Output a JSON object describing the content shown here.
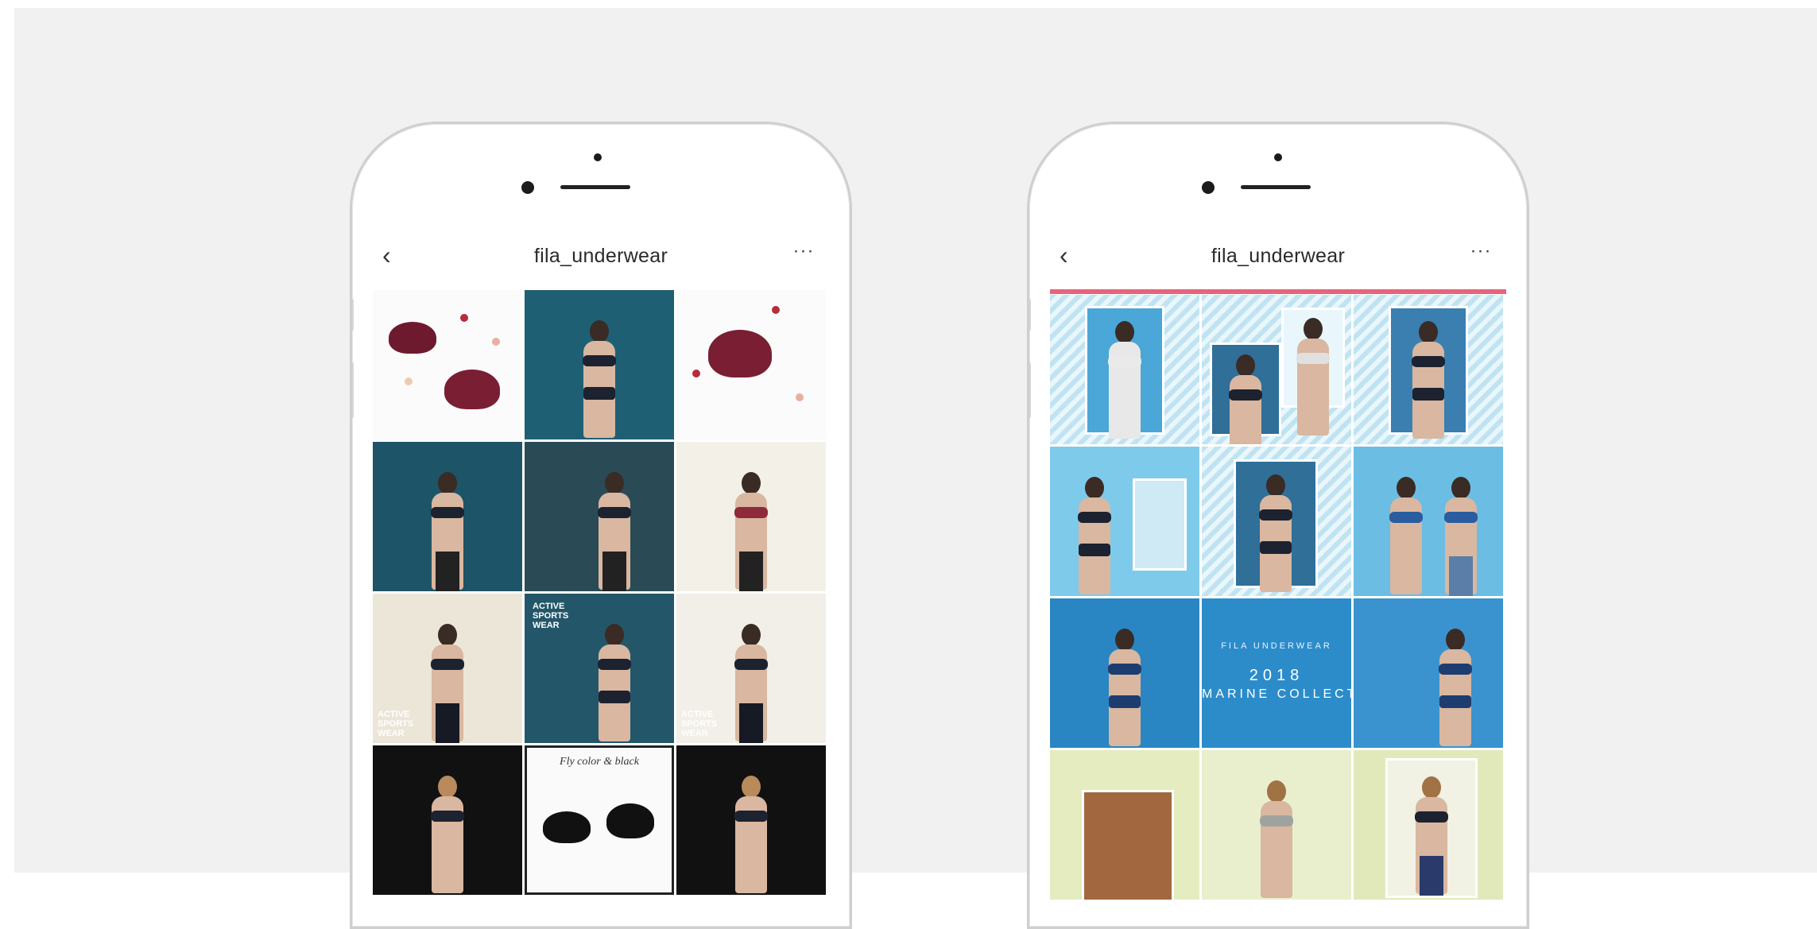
{
  "phones": [
    {
      "title": "fila_underwear",
      "back_icon": "‹",
      "more_icon": "···"
    },
    {
      "title": "fila_underwear",
      "back_icon": "‹",
      "more_icon": "···"
    }
  ],
  "right_banner": {
    "subtitle": "FILA UNDERWEAR",
    "year": "2018",
    "collection": "MARINE COLLECTION"
  },
  "left_tiles": {
    "caption": "Fly color & black",
    "tag_a": "ACTIVE\nSPORTS\nWEAR",
    "tag_b": "ACTIVE\nSPORTS\nWEAR",
    "tag_c": "ACTIVE\nSPORTS\nWEAR"
  },
  "colors": {
    "accent_pink": "#e6647c",
    "teal": "#1f5f73",
    "burgundy": "#7a1f33",
    "sky": "#5bb5e0",
    "lime": "#e4ecc0"
  }
}
